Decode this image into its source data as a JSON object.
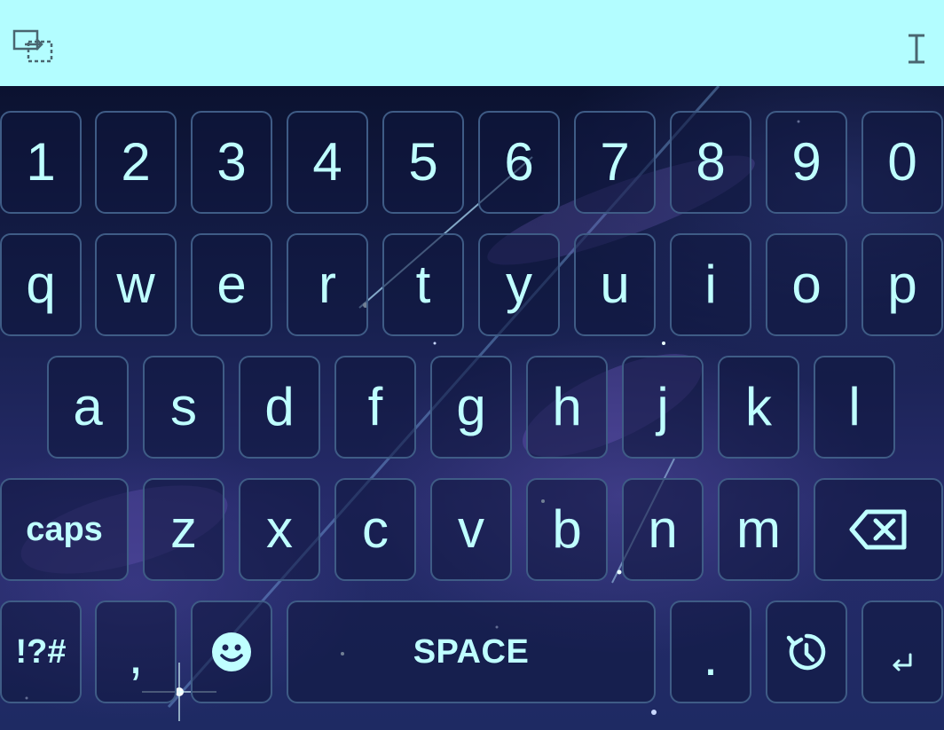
{
  "toolbar": {
    "left_icon": "move-selection-icon",
    "right_icon": "text-cursor-icon",
    "background_color": "#b3fdff",
    "icon_color": "#4a6670"
  },
  "keyboard": {
    "key_text_color": "#bfffff",
    "key_border_color": "#3f5c86",
    "rows": {
      "numbers": [
        "1",
        "2",
        "3",
        "4",
        "5",
        "6",
        "7",
        "8",
        "9",
        "0"
      ],
      "top": [
        "q",
        "w",
        "e",
        "r",
        "t",
        "y",
        "u",
        "i",
        "o",
        "p"
      ],
      "home": [
        "a",
        "s",
        "d",
        "f",
        "g",
        "h",
        "j",
        "k",
        "l"
      ],
      "bottom": [
        "z",
        "x",
        "c",
        "v",
        "b",
        "n",
        "m"
      ]
    },
    "caps_label": "caps",
    "backspace_icon": "backspace-icon",
    "symbols_label": "!?#",
    "comma_label": ",",
    "emoji_icon": "smiley-icon",
    "space_label": "SPACE",
    "period_label": ".",
    "history_icon": "clock-rotate-icon",
    "enter_icon": "enter-arrow-icon"
  }
}
